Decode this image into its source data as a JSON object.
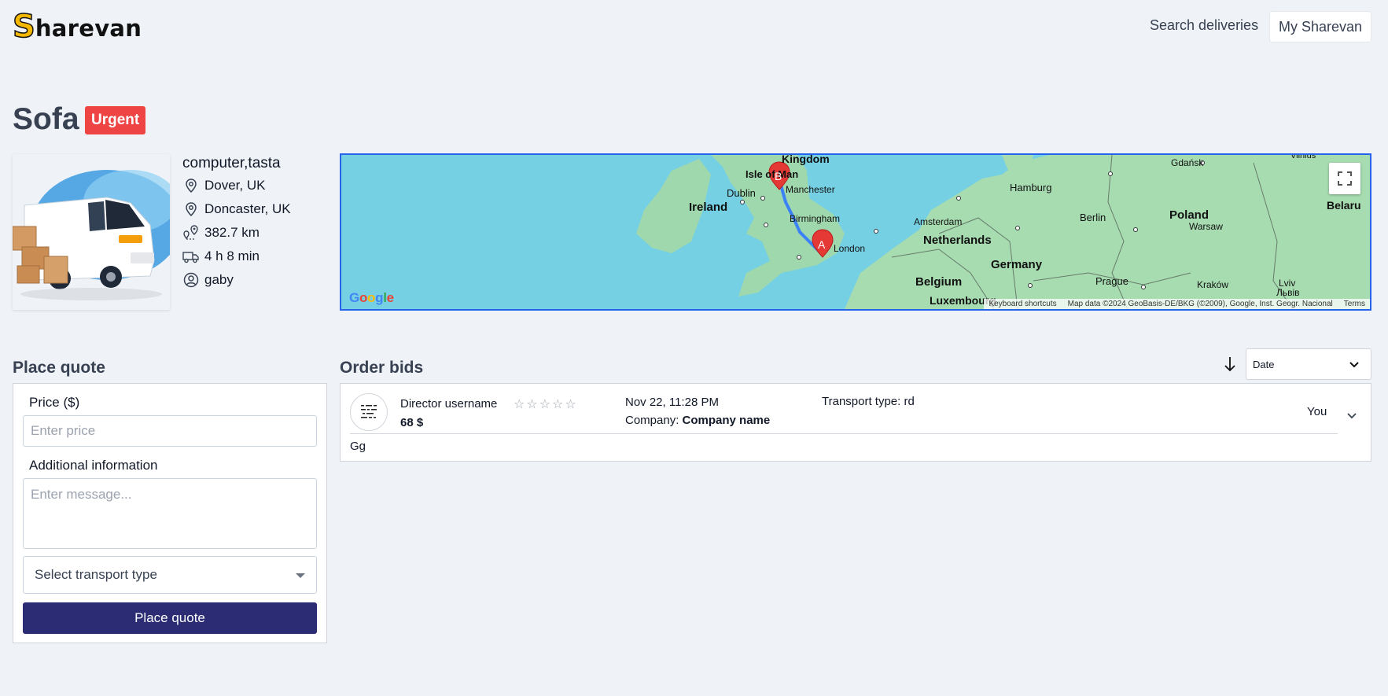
{
  "header": {
    "logo_first": "S",
    "logo_rest": "harevan",
    "nav_search": "Search deliveries",
    "nav_account": "My Sharevan"
  },
  "order": {
    "title": "Sofa",
    "badge": "Urgent",
    "items": "computer,tasta",
    "origin": "Dover, UK",
    "destination": "Doncaster, UK",
    "distance": "382.7 km",
    "duration": "4 h 8 min",
    "user": "gaby"
  },
  "map": {
    "labels": {
      "kingdom": "Kingdom",
      "isle_of_man": "Isle of Man",
      "manchester": "Manchester",
      "dublin": "Dublin",
      "ireland": "Ireland",
      "birmingham": "Birmingham",
      "london": "London",
      "amsterdam": "Amsterdam",
      "netherlands": "Netherlands",
      "hamburg": "Hamburg",
      "berlin": "Berlin",
      "germany": "Germany",
      "belgium": "Belgium",
      "luxembourg": "Luxembourg",
      "prague": "Prague",
      "poland": "Poland",
      "warsaw": "Warsaw",
      "gdansk": "Gdańsk",
      "krakow": "Kraków",
      "lviv": "Lviv",
      "lviv_local": "Львів",
      "belarus": "Belaru",
      "vilnius": "Vilnius"
    },
    "marker_a": "A",
    "marker_b": "B",
    "google": "Google",
    "attr_shortcuts": "Keyboard shortcuts",
    "attr_data": "Map data ©2024 GeoBasis-DE/BKG (©2009), Google, Inst. Geogr. Nacional",
    "attr_terms": "Terms"
  },
  "quote": {
    "section_title": "Place quote",
    "price_label": "Price ($)",
    "price_placeholder": "Enter price",
    "info_label": "Additional information",
    "info_placeholder": "Enter message...",
    "transport_placeholder": "Select transport type",
    "submit_label": "Place quote"
  },
  "bids": {
    "section_title": "Order bids",
    "sort_value": "Date",
    "items": [
      {
        "username": "Director username",
        "price": "68 $",
        "rating": 0,
        "stars": "☆☆☆☆☆",
        "date": "Nov 22, 11:28 PM",
        "company_label": "Company:",
        "company": "Company name",
        "transport": "Transport type: rd",
        "you": "You",
        "message": "Gg"
      }
    ]
  },
  "colors": {
    "background": "#eff3f8",
    "urgent": "#ef4444",
    "primary_button": "#2c2c75",
    "map_border": "#2563eb",
    "route": "#3b82f6",
    "marker": "#e53935",
    "logo_accent": "#f5b800"
  }
}
